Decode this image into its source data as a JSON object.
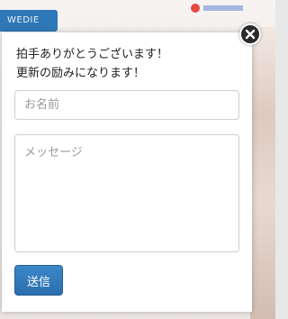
{
  "background": {
    "tab_label": "WEDIE"
  },
  "clap_modal": {
    "message_line1": "拍手ありがとうございます！",
    "message_line2": "更新の励みになります！",
    "name_placeholder": "お名前",
    "name_value": "",
    "message_placeholder": "メッセージ",
    "message_value": "",
    "send_label": "送信",
    "close_icon": "close-icon",
    "accent_color": "#2f78b7"
  }
}
